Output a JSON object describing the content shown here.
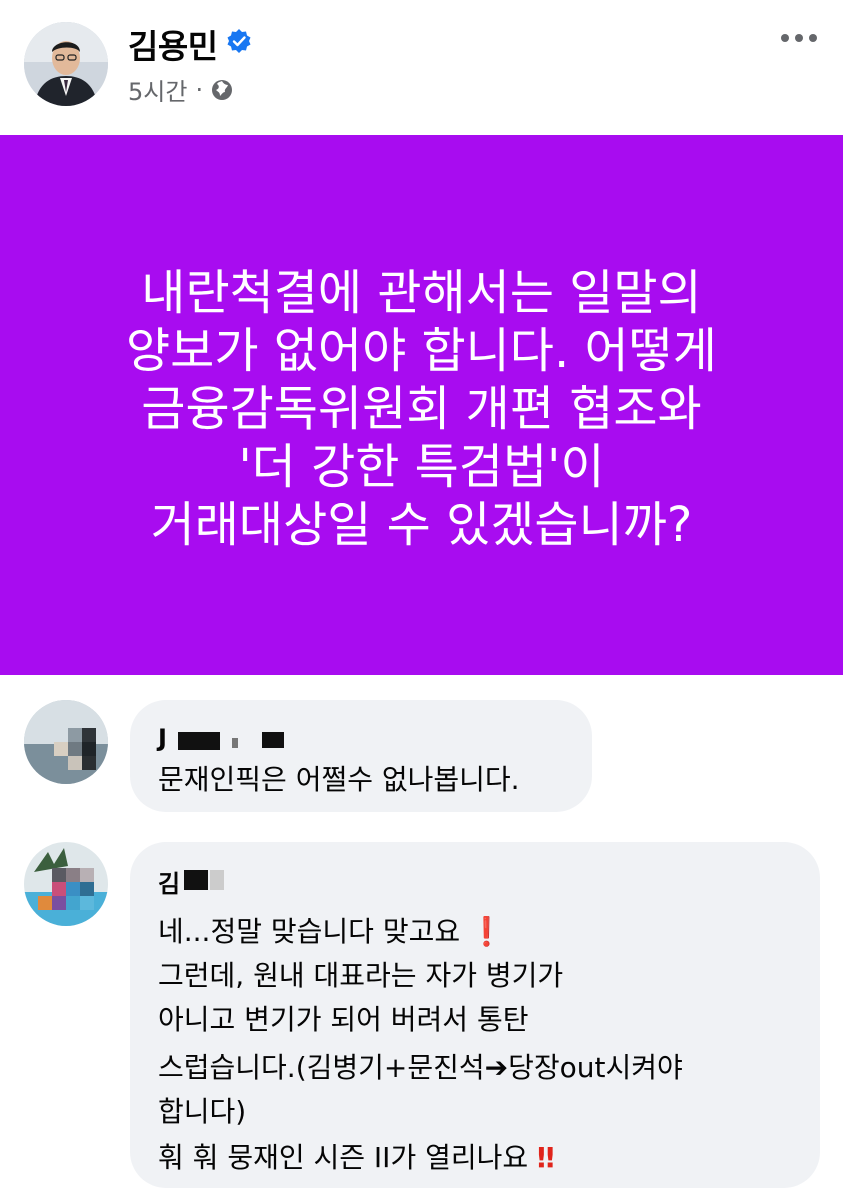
{
  "post": {
    "author": "김용민",
    "time": "5시간",
    "separator": "·",
    "card_lines": [
      "내란척결에 관해서는 일말의",
      "양보가 없어야 합니다. 어떻게",
      "금융감독위원회 개편 협조와",
      "'더 강한 특검법'이",
      "거래대상일 수 있겠습니까?"
    ]
  },
  "icons": {
    "verified": "verified-badge-icon",
    "audience": "globe-icon",
    "more": "more-horizontal-icon"
  },
  "colors": {
    "card_bg": "#a80cf0",
    "bubble_bg": "#f0f2f5",
    "verified": "#1877f2"
  },
  "comments": [
    {
      "name_visible": "J",
      "text": "문재인픽은 어쩔수 없나봅니다."
    },
    {
      "name_visible": "김",
      "lines": [
        "네...정말 맞습니다 맞고요",
        "그런데, 원내 대표라는 자가 병기가",
        "아니고 변기가 되어 버려서 통탄",
        "스럽습니다.(김병기+문진석",
        "당장out시켜야",
        "합니다)",
        "훠 훠 뭉재인 시즌 II가 열리나요"
      ],
      "emoji_exclaim": "❗",
      "emoji_double": "‼",
      "arrow": "➔"
    }
  ]
}
